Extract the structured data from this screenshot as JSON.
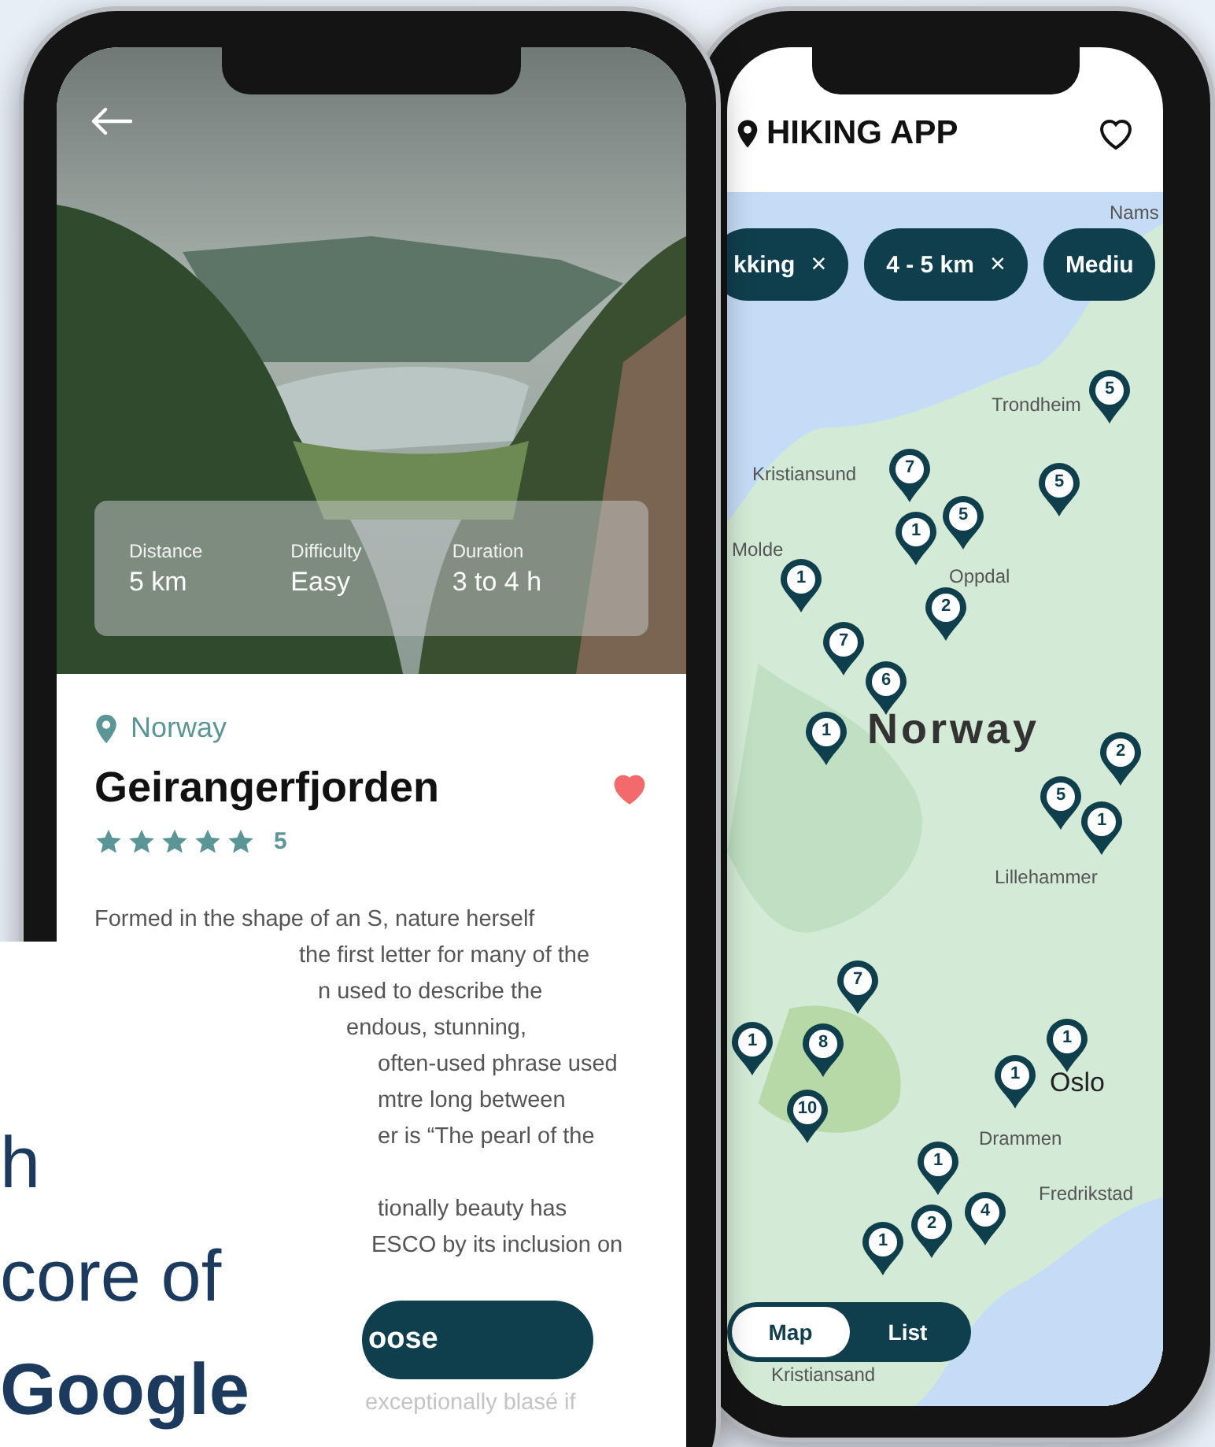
{
  "detail": {
    "stats": [
      {
        "label": "Distance",
        "value": "5 km"
      },
      {
        "label": "Difficulty",
        "value": "Easy"
      },
      {
        "label": "Duration",
        "value": "3 to 4 h"
      }
    ],
    "location": "Norway",
    "title": "Geirangerfjorden",
    "favorite": true,
    "stars": 5,
    "rating": "5",
    "description": [
      [
        "Formed in the shape of an S, nature herself",
        "the first letter for many of the",
        "n used to describe the",
        "endous, stunning,",
        "often-used phrase used",
        "mtre long between",
        "er is “The pearl of the"
      ],
      [
        "tionally beauty has",
        "ESCO by its inclusion on"
      ]
    ],
    "button": "oose",
    "after_button": "exceptionally blasé if"
  },
  "overlay_lines": [
    {
      "text": "h",
      "bold": false
    },
    {
      "text": "core of",
      "bold": false
    },
    {
      "text": "Google",
      "bold": true
    }
  ],
  "map_app": {
    "title": "HIKING APP",
    "favorite": false,
    "filters": [
      {
        "label": "kking",
        "remove": "×"
      },
      {
        "label": "4 - 5 km",
        "remove": "×"
      },
      {
        "label": "Mediu"
      }
    ],
    "places": [
      {
        "text": "Nams",
        "kind": "city"
      },
      {
        "text": "Trondheim",
        "kind": "city"
      },
      {
        "text": "Kristiansund",
        "kind": "city"
      },
      {
        "text": "Molde",
        "kind": "city"
      },
      {
        "text": "Oppdal",
        "kind": "city"
      },
      {
        "text": "Norway",
        "kind": "country"
      },
      {
        "text": "Lillehammer",
        "kind": "city"
      },
      {
        "text": "Oslo",
        "kind": "capital"
      },
      {
        "text": "Drammen",
        "kind": "city"
      },
      {
        "text": "Fredrikstad",
        "kind": "city"
      },
      {
        "text": "Kristiansand",
        "kind": "city"
      }
    ],
    "pins": [
      {
        "count": "5"
      },
      {
        "count": "5"
      },
      {
        "count": "7"
      },
      {
        "count": "1"
      },
      {
        "count": "5"
      },
      {
        "count": "1"
      },
      {
        "count": "2"
      },
      {
        "count": "7"
      },
      {
        "count": "6"
      },
      {
        "count": "1"
      },
      {
        "count": "2"
      },
      {
        "count": "5"
      },
      {
        "count": "1"
      },
      {
        "count": "7"
      },
      {
        "count": "1"
      },
      {
        "count": "8"
      },
      {
        "count": "1"
      },
      {
        "count": "1"
      },
      {
        "count": "10"
      },
      {
        "count": "1"
      },
      {
        "count": "2"
      },
      {
        "count": "4"
      },
      {
        "count": "1"
      }
    ],
    "view_toggle": [
      {
        "label": "Map",
        "selected": true
      },
      {
        "label": "List",
        "selected": false
      }
    ]
  }
}
